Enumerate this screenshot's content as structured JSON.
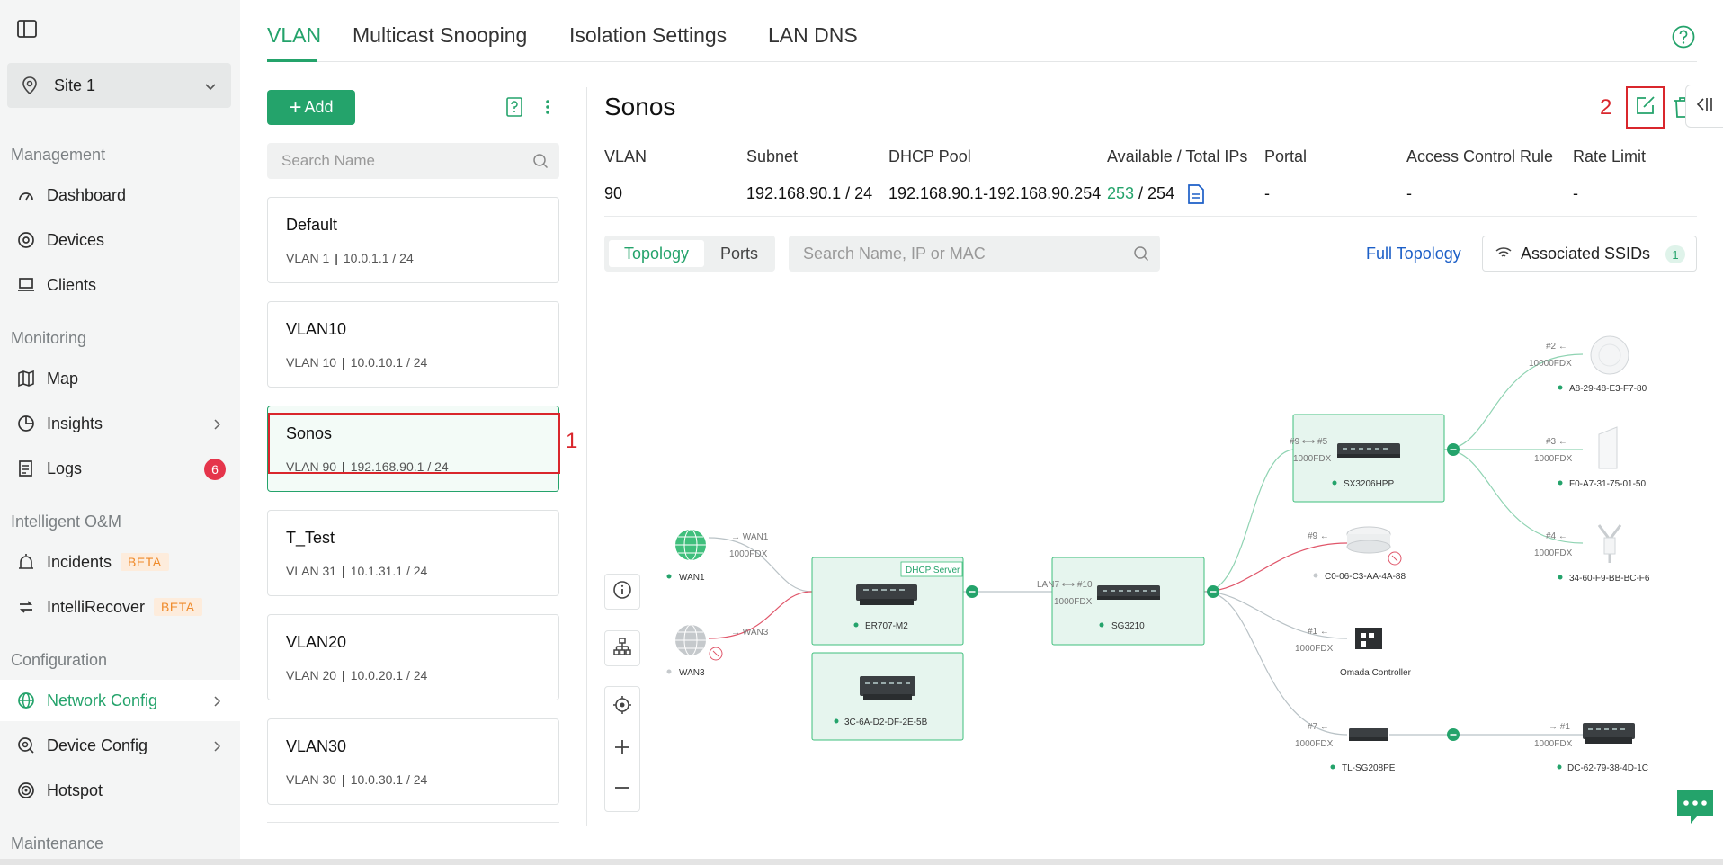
{
  "sidebar": {
    "site_label": "Site 1",
    "sections": {
      "management": "Management",
      "monitoring": "Monitoring",
      "intelligent": "Intelligent O&M",
      "configuration": "Configuration",
      "maintenance": "Maintenance"
    },
    "items": {
      "dashboard": "Dashboard",
      "devices": "Devices",
      "clients": "Clients",
      "map": "Map",
      "insights": "Insights",
      "logs": "Logs",
      "logs_badge": "6",
      "incidents": "Incidents",
      "intellirecover": "IntelliRecover",
      "beta": "BETA",
      "network_config": "Network Config",
      "device_config": "Device Config",
      "hotspot": "Hotspot"
    }
  },
  "tabs": [
    "VLAN",
    "Multicast Snooping",
    "Isolation Settings",
    "LAN DNS"
  ],
  "vlan_list": {
    "add_label": "Add",
    "search_placeholder": "Search Name",
    "items": [
      {
        "name": "Default",
        "vlan": "VLAN 1",
        "subnet": "10.0.1.1 / 24"
      },
      {
        "name": "VLAN10",
        "vlan": "VLAN 10",
        "subnet": "10.0.10.1 / 24"
      },
      {
        "name": "Sonos",
        "vlan": "VLAN 90",
        "subnet": "192.168.90.1 / 24"
      },
      {
        "name": "T_Test",
        "vlan": "VLAN 31",
        "subnet": "10.1.31.1 / 24"
      },
      {
        "name": "VLAN20",
        "vlan": "VLAN 20",
        "subnet": "10.0.20.1 / 24"
      },
      {
        "name": "VLAN30",
        "vlan": "VLAN 30",
        "subnet": "10.0.30.1 / 24"
      }
    ]
  },
  "annotations": {
    "one": "1",
    "two": "2"
  },
  "detail": {
    "title": "Sonos",
    "headers": {
      "vlan": "VLAN",
      "subnet": "Subnet",
      "dhcp_pool": "DHCP Pool",
      "available": "Available / Total IPs",
      "portal": "Portal",
      "acl": "Access Control Rule",
      "rate": "Rate Limit"
    },
    "values": {
      "vlan": "90",
      "subnet": "192.168.90.1 / 24",
      "dhcp_pool": "192.168.90.1-192.168.90.254",
      "available": "253",
      "total": " / 254",
      "portal": "-",
      "acl": "-",
      "rate": "-"
    }
  },
  "topology": {
    "view_topology": "Topology",
    "view_ports": "Ports",
    "search_placeholder": "Search Name, IP or MAC",
    "full_topology": "Full Topology",
    "assoc_ssids": "Associated SSIDs",
    "assoc_count": "1",
    "colors": {
      "green": "#24a36b",
      "red": "#e0566a",
      "node_bg": "#e6f5ee"
    },
    "labels": {
      "wan1": "WAN1",
      "wan3": "WAN3",
      "to_wan1": "→ WAN1",
      "to_wan3": "→ WAN3",
      "fdx_1000": "1000FDX",
      "fdx_10000": "10000FDX",
      "dhcp_server": "DHCP Server",
      "router": "ER707-M2",
      "router2": "3C-6A-D2-DF-2E-5B",
      "lan_link": "LAN7 ⟷ #10",
      "switch_core": "SG3210",
      "switch_hpp": "SX3206HPP",
      "hpp_link": "#9 ⟷ #5",
      "ap_ceiling": "C0-06-C3-AA-4A-88",
      "ap_ceiling_port": "#9 ←",
      "controller": "Omada Controller",
      "controller_port": "#1 ←",
      "tl_switch": "TL-SG208PE",
      "tl_port": "#7 ←",
      "dc_switch": "DC-62-79-38-4D-1C",
      "dc_port": "→ #1",
      "ap1": "A8-29-48-E3-F7-80",
      "ap1_port": "#2 ←",
      "ap2": "F0-A7-31-75-01-50",
      "ap2_port": "#3 ←",
      "ap3": "34-60-F9-BB-BC-F6",
      "ap3_port": "#4 ←"
    }
  }
}
